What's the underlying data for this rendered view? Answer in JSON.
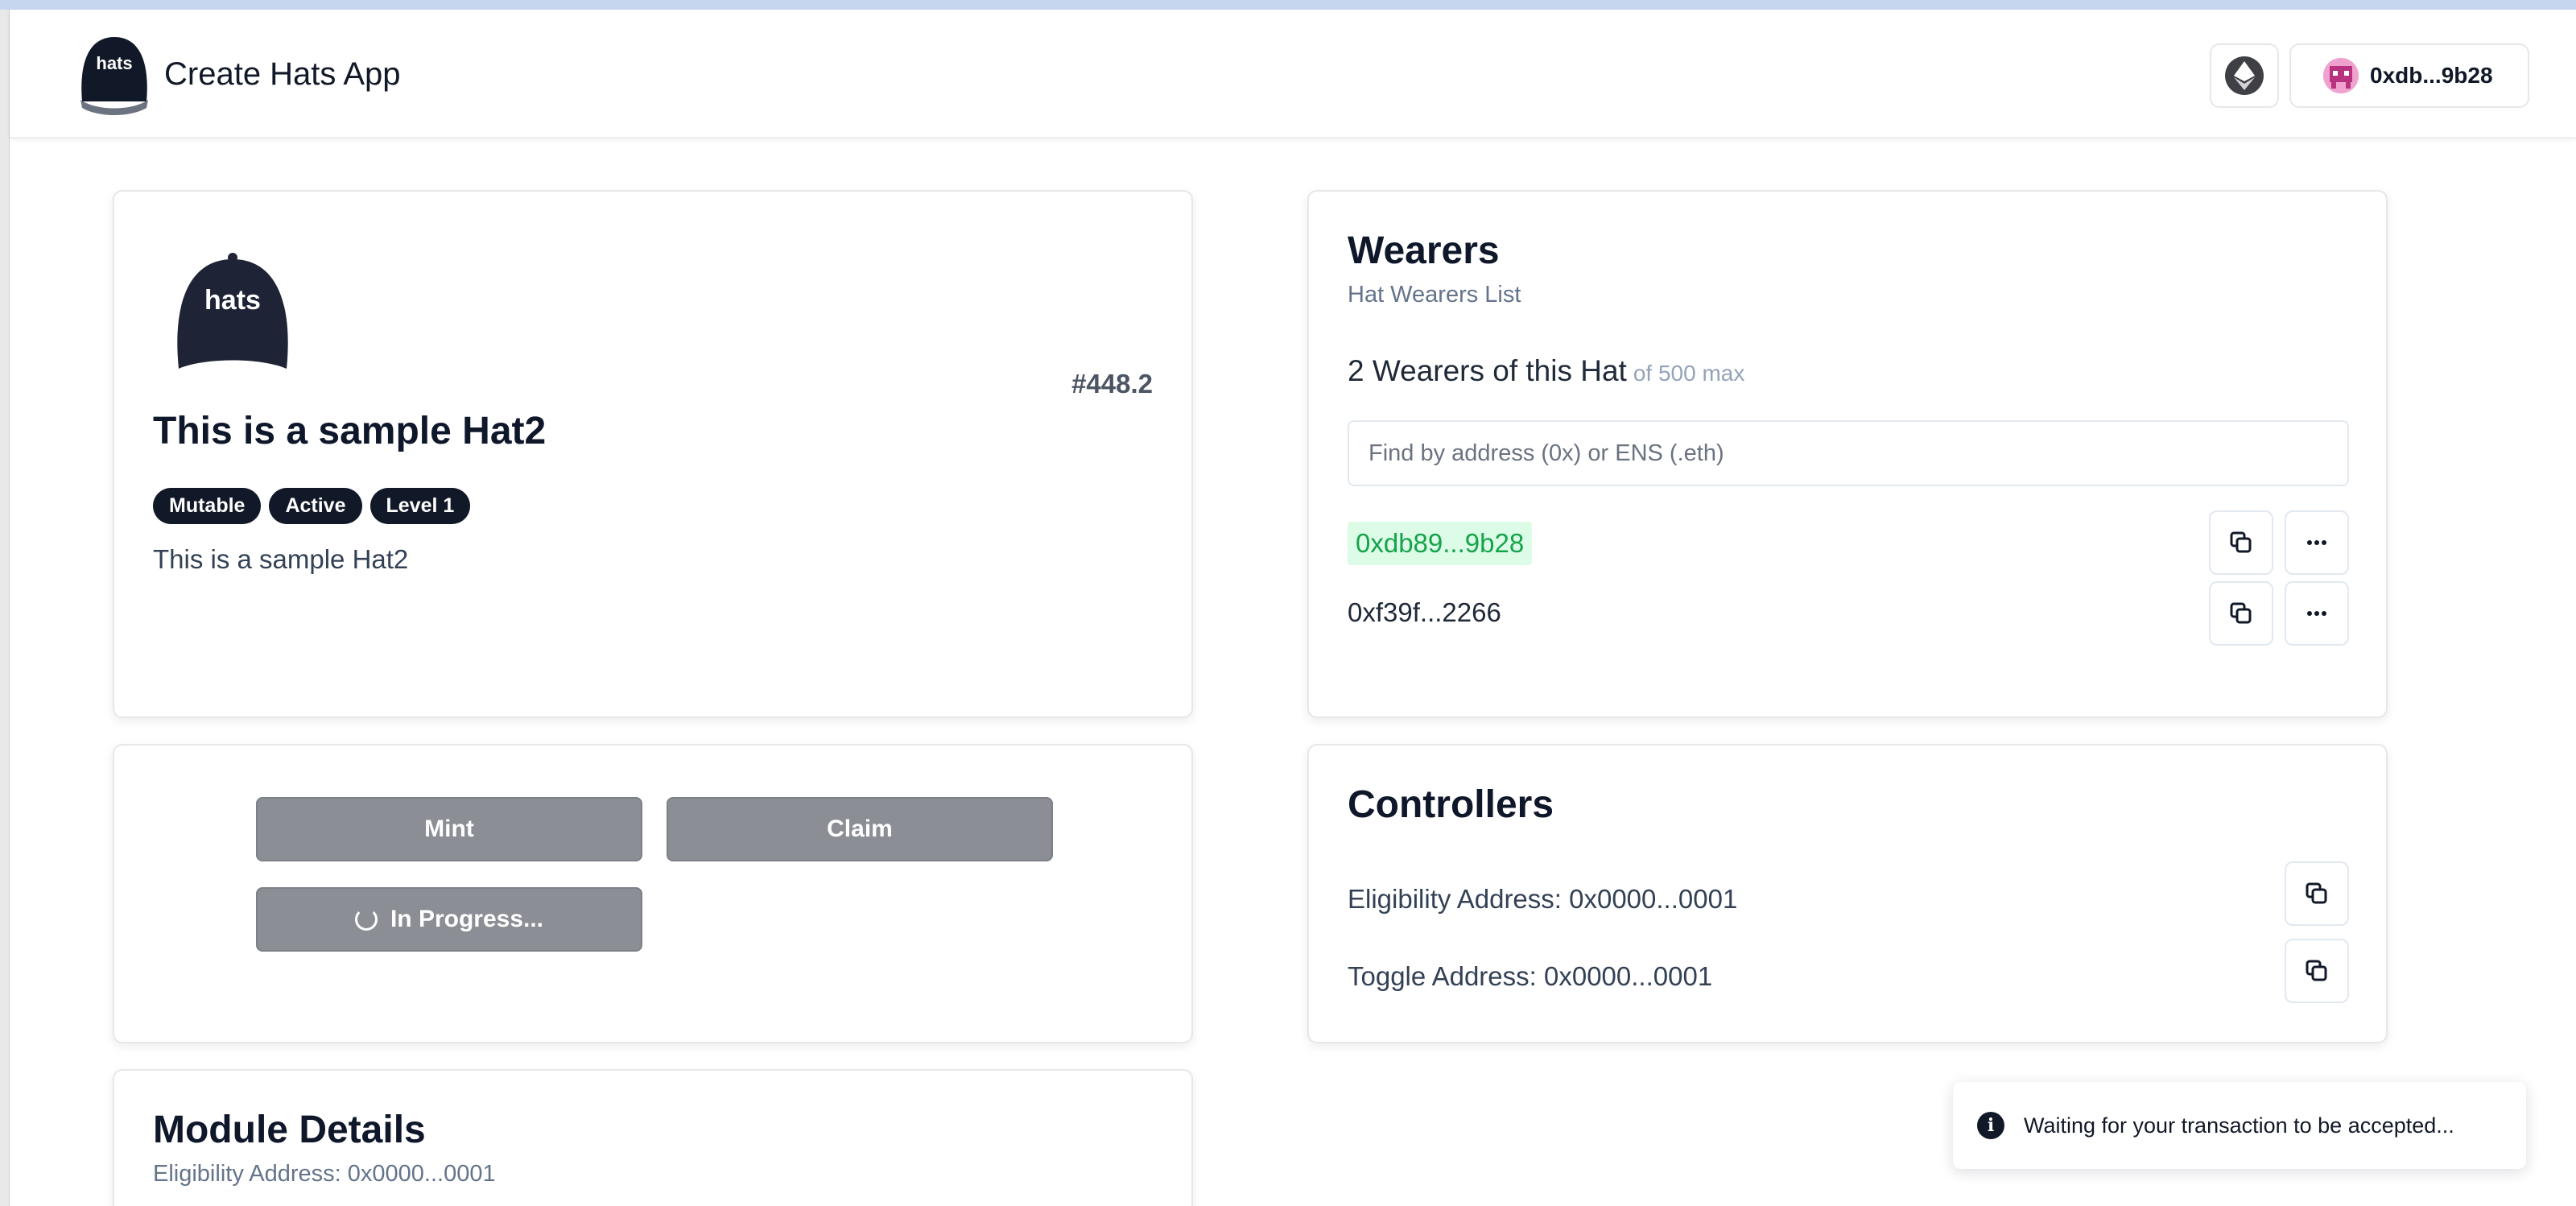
{
  "app": {
    "title": "Create Hats App",
    "logo_text": "hats",
    "account_label": "0xdb...9b28"
  },
  "hat": {
    "logo_text": "hats",
    "id": "#448.2",
    "title": "This is a sample Hat2",
    "badges": [
      "Mutable",
      "Active",
      "Level 1"
    ],
    "description": "This is a sample Hat2"
  },
  "actions": {
    "mint_label": "Mint",
    "claim_label": "Claim",
    "progress_label": "In Progress..."
  },
  "module": {
    "title": "Module Details",
    "eligibility": "Eligibility Address: 0x0000...0001"
  },
  "wearers": {
    "title": "Wearers",
    "subtitle": "Hat Wearers List",
    "count_text": "2 Wearers of this Hat",
    "max_text": "of 500 max",
    "search_placeholder": "Find by address (0x) or ENS (.eth)",
    "list": [
      "0xdb89...9b28",
      "0xf39f...2266"
    ]
  },
  "controllers": {
    "title": "Controllers",
    "eligibility": "Eligibility Address: 0x0000...0001",
    "toggle": "Toggle Address: 0x0000...0001"
  },
  "toast": {
    "message": "Waiting for your transaction to be accepted..."
  },
  "colors": {
    "accent_dark": "#111827",
    "button_gray": "#8b8e95",
    "wearer_highlight_bg": "#dcfce7",
    "wearer_highlight_text": "#16a34a"
  }
}
